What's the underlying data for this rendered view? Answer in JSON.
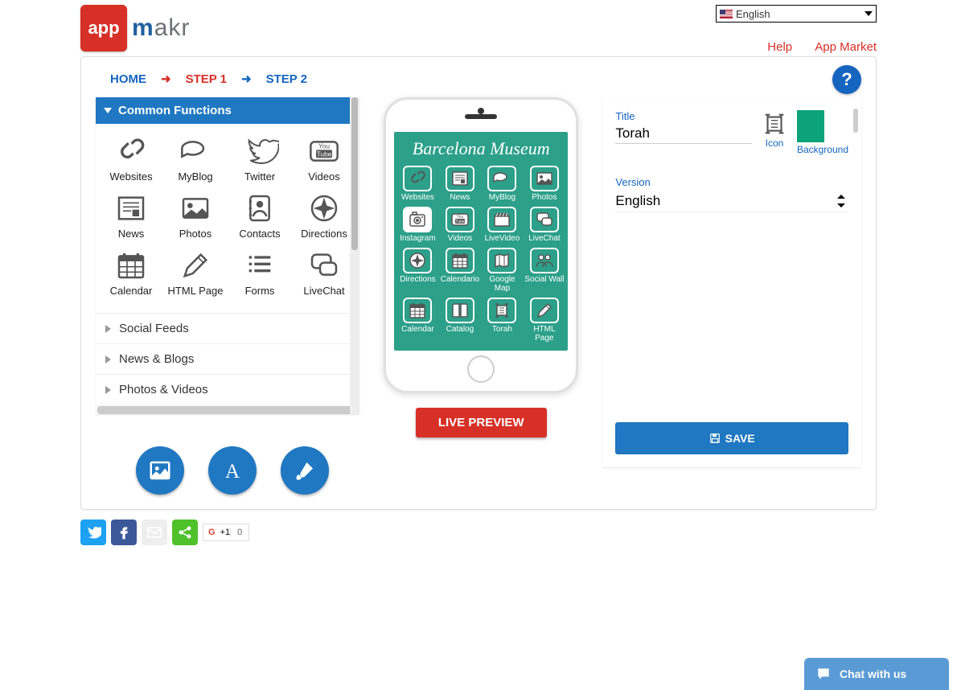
{
  "lang": {
    "label": "English"
  },
  "topLinks": {
    "help": "Help",
    "market": "App Market"
  },
  "logo": {
    "box": "app",
    "rest": "makr"
  },
  "breadcrumb": {
    "home": "HOME",
    "step1": "STEP 1",
    "step2": "STEP 2"
  },
  "accordion": {
    "open": "Common Functions",
    "closed": [
      "Social Feeds",
      "News & Blogs",
      "Photos & Videos"
    ]
  },
  "functions": [
    {
      "label": "Websites",
      "icon": "link"
    },
    {
      "label": "MyBlog",
      "icon": "bubble"
    },
    {
      "label": "Twitter",
      "icon": "bird"
    },
    {
      "label": "Videos",
      "icon": "youtube"
    },
    {
      "label": "News",
      "icon": "news"
    },
    {
      "label": "Photos",
      "icon": "photo"
    },
    {
      "label": "Contacts",
      "icon": "contacts"
    },
    {
      "label": "Directions",
      "icon": "compass"
    },
    {
      "label": "Calendar",
      "icon": "calendar"
    },
    {
      "label": "HTML Page",
      "icon": "pencil"
    },
    {
      "label": "Forms",
      "icon": "forms"
    },
    {
      "label": "LiveChat",
      "icon": "chat"
    }
  ],
  "phone": {
    "title": "Barcelona Museum",
    "cells": [
      {
        "label": "Websites",
        "icon": "link"
      },
      {
        "label": "News",
        "icon": "news"
      },
      {
        "label": "MyBlog",
        "icon": "bubble"
      },
      {
        "label": "Photos",
        "icon": "photo"
      },
      {
        "label": "Instagram",
        "icon": "camera",
        "selected": true
      },
      {
        "label": "Videos",
        "icon": "youtube"
      },
      {
        "label": "LiveVideo",
        "icon": "clap"
      },
      {
        "label": "LiveChat",
        "icon": "chat"
      },
      {
        "label": "Directions",
        "icon": "compass"
      },
      {
        "label": "Calendario",
        "icon": "calendar"
      },
      {
        "label": "Google Map",
        "icon": "map"
      },
      {
        "label": "Social Wall",
        "icon": "people"
      },
      {
        "label": "Calendar",
        "icon": "calendar"
      },
      {
        "label": "Catalog",
        "icon": "book"
      },
      {
        "label": "Torah",
        "icon": "scroll"
      },
      {
        "label": "HTML Page",
        "icon": "pencil"
      }
    ]
  },
  "livePreview": "LIVE PREVIEW",
  "right": {
    "titleLabel": "Title",
    "titleValue": "Torah",
    "iconLabel": "Icon",
    "bgLabel": "Background",
    "versionLabel": "Version",
    "versionValue": "English",
    "save": "SAVE"
  },
  "gplus": {
    "label": "+1",
    "count": "0"
  },
  "chat": "Chat with us"
}
